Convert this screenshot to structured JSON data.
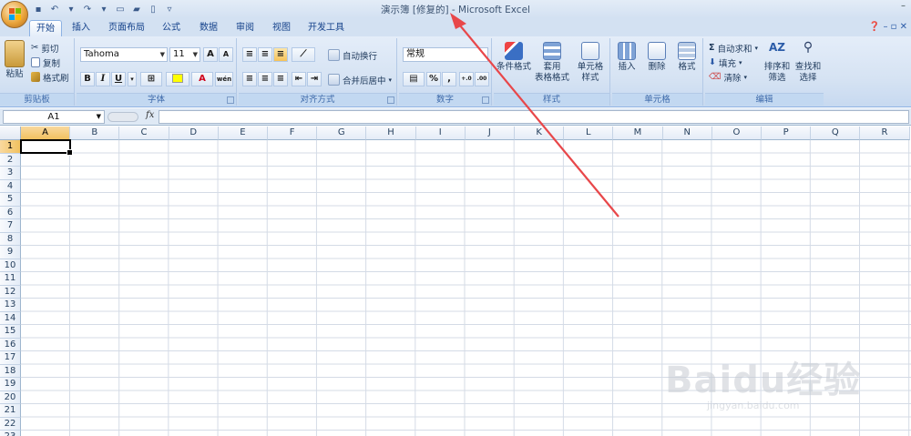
{
  "window": {
    "title": "演示簿 [修复的] - Microsoft Excel"
  },
  "tabs": [
    "开始",
    "插入",
    "页面布局",
    "公式",
    "数据",
    "审阅",
    "视图",
    "开发工具"
  ],
  "active_tab": "开始",
  "clipboard": {
    "paste": "粘贴",
    "cut": "剪切",
    "copy": "复制",
    "format_painter": "格式刷",
    "label": "剪贴板"
  },
  "font": {
    "name": "Tahoma",
    "size": "11",
    "bold": "B",
    "italic": "I",
    "underline": "U",
    "grow": "A",
    "shrink": "A",
    "color_letter": "A",
    "phonetic": "wén",
    "label": "字体"
  },
  "alignment": {
    "wrap": "自动换行",
    "merge": "合并后居中",
    "label": "对齐方式"
  },
  "number": {
    "format": "常规",
    "percent": "%",
    "comma": ",",
    "inc_decimal": "+.0",
    "dec_decimal": ".00",
    "label": "数字"
  },
  "styles": {
    "conditional": "条件格式",
    "table_1": "套用",
    "table_2": "表格格式",
    "cell_1": "单元格",
    "cell_2": "样式",
    "label": "样式"
  },
  "cells": {
    "insert": "插入",
    "delete": "删除",
    "format": "格式",
    "label": "单元格"
  },
  "editing": {
    "autosum": "自动求和",
    "fill": "填充",
    "clear": "清除",
    "sort_1": "排序和",
    "sort_2": "筛选",
    "find_1": "查找和",
    "find_2": "选择",
    "label": "编辑"
  },
  "formula_bar": {
    "name_box": "A1",
    "fx": "fx",
    "value": ""
  },
  "sheet": {
    "columns": [
      "A",
      "B",
      "C",
      "D",
      "E",
      "F",
      "G",
      "H",
      "I",
      "J",
      "K",
      "L",
      "M",
      "N",
      "O",
      "P",
      "Q",
      "R"
    ],
    "rows": [
      "1",
      "2",
      "3",
      "4",
      "5",
      "6",
      "7",
      "8",
      "9",
      "10",
      "11",
      "12",
      "13",
      "14",
      "15",
      "16",
      "17",
      "18",
      "19",
      "20",
      "21",
      "22",
      "23"
    ],
    "active_cell": "A1"
  },
  "watermark": {
    "text": "Baidu经验",
    "url": "jingyan.baidu.com"
  },
  "colors": {
    "ribbon": "#d6e3f3",
    "selected_header": "#f1c15f",
    "arrow": "#e8474a"
  }
}
